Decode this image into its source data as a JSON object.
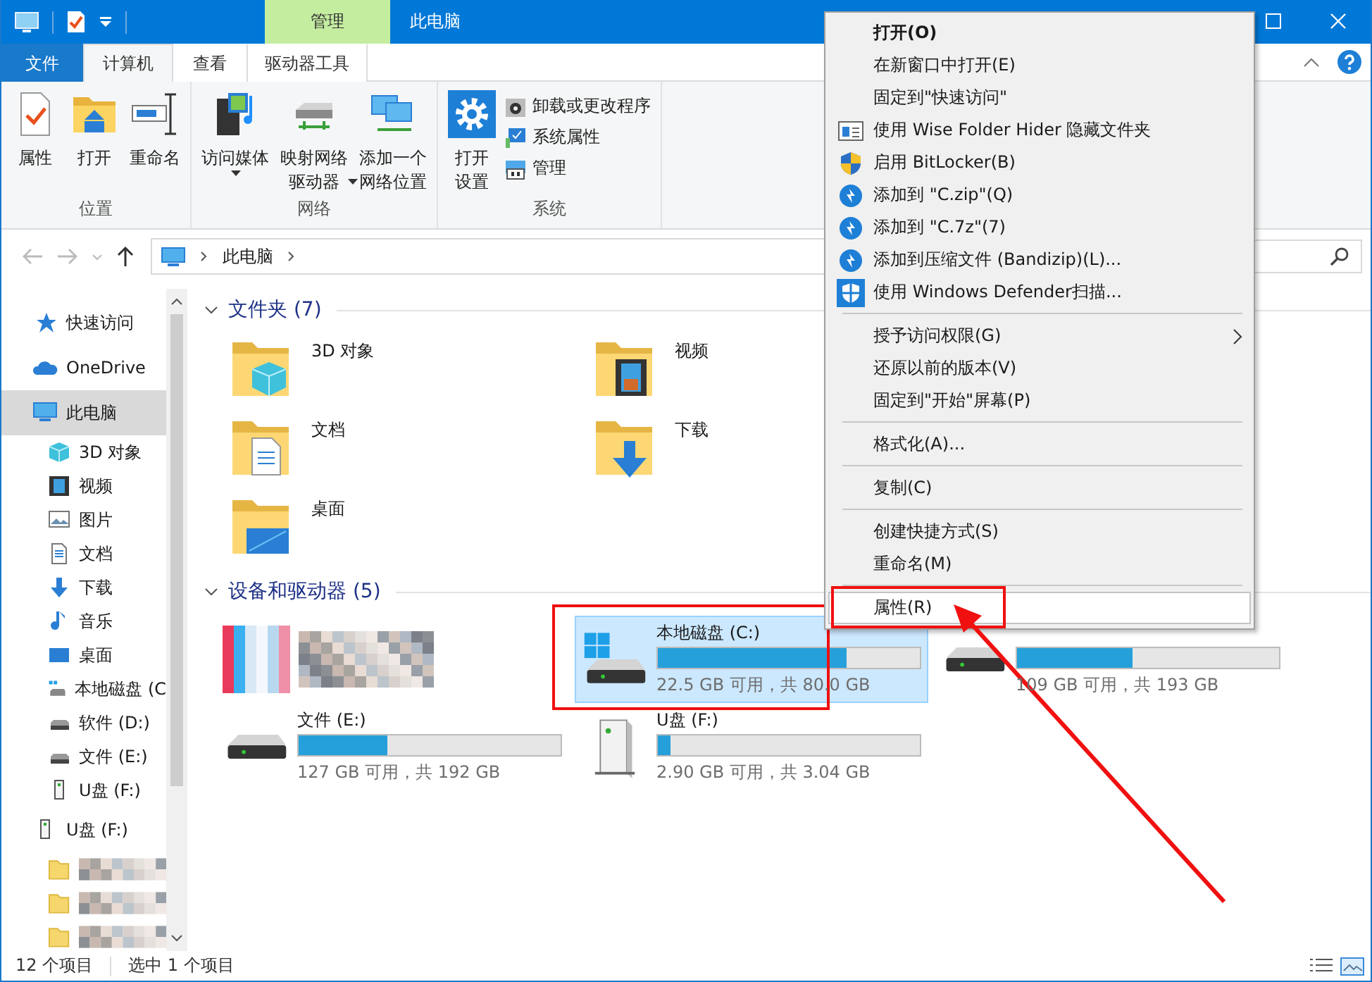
{
  "window": {
    "title": "此电脑",
    "context_tab_group": "管理"
  },
  "ribbon_tabs": [
    {
      "label": "文件",
      "kind": "file",
      "selected": false
    },
    {
      "label": "计算机",
      "kind": "tab",
      "selected": true
    },
    {
      "label": "查看",
      "kind": "tab",
      "selected": false
    },
    {
      "label": "驱动器工具",
      "kind": "context",
      "selected": false
    }
  ],
  "ribbon_groups": [
    {
      "name": "位置",
      "buttons": [
        {
          "lines": [
            "属性"
          ],
          "kind": "properties",
          "dropdown": false
        },
        {
          "lines": [
            "打开"
          ],
          "kind": "open",
          "dropdown": false
        },
        {
          "lines": [
            "重命名"
          ],
          "kind": "rename",
          "dropdown": false
        }
      ]
    },
    {
      "name": "网络",
      "buttons": [
        {
          "lines": [
            "访问媒体"
          ],
          "kind": "media",
          "dropdown": true
        },
        {
          "lines": [
            "映射网络",
            "驱动器"
          ],
          "kind": "map-drive",
          "dropdown": true
        },
        {
          "lines": [
            "添加一个",
            "网络位置"
          ],
          "kind": "network-location",
          "dropdown": false
        }
      ]
    },
    {
      "name": "系统",
      "buttons": [
        {
          "lines": [
            "打开",
            "设置"
          ],
          "kind": "settings",
          "dropdown": false
        }
      ],
      "small_buttons": [
        {
          "label": "卸载或更改程序",
          "kind": "uninstall"
        },
        {
          "label": "系统属性",
          "kind": "system-properties"
        },
        {
          "label": "管理",
          "kind": "manage"
        }
      ]
    }
  ],
  "address": {
    "path": [
      "此电脑"
    ]
  },
  "navigation": [
    {
      "label": "快速访问",
      "kind": "star",
      "selected": false
    },
    {
      "label": "OneDrive",
      "kind": "cloud",
      "selected": false
    },
    {
      "label": "此电脑",
      "kind": "pc",
      "selected": true,
      "children": [
        {
          "label": "3D 对象",
          "kind": "cube"
        },
        {
          "label": "视频",
          "kind": "video"
        },
        {
          "label": "图片",
          "kind": "picture"
        },
        {
          "label": "文档",
          "kind": "document"
        },
        {
          "label": "下载",
          "kind": "download"
        },
        {
          "label": "音乐",
          "kind": "music"
        },
        {
          "label": "桌面",
          "kind": "desktop"
        },
        {
          "label": "本地磁盘 (C",
          "kind": "windows"
        },
        {
          "label": "软件 (D:)",
          "kind": "hdd"
        },
        {
          "label": "文件 (E:)",
          "kind": "hdd"
        },
        {
          "label": "U盘 (F:)",
          "kind": "usb"
        }
      ]
    },
    {
      "label": "U盘 (F:)",
      "kind": "usb",
      "selected": false,
      "children": [
        {
          "kind": "blurred"
        },
        {
          "kind": "blurred"
        },
        {
          "kind": "blurred"
        }
      ]
    }
  ],
  "sections": [
    {
      "title": "文件夹 (7)",
      "kind": "folders",
      "expanded": true,
      "items": [
        {
          "name": "3D 对象",
          "kind": "cube"
        },
        {
          "name": "视频",
          "kind": "video"
        },
        {
          "name": "文档",
          "kind": "document"
        },
        {
          "name": "下载",
          "kind": "download"
        },
        {
          "name": "桌面",
          "kind": "desktop"
        }
      ]
    },
    {
      "title": "设备和驱动器 (5)",
      "kind": "drives",
      "expanded": true,
      "items": [
        {
          "kind": "blurred",
          "selected": false
        },
        {
          "kind": "windows",
          "name": "本地磁盘 (C:)",
          "level": 0.72,
          "space": "22.5 GB 可用，共 80.0 GB",
          "selected": true,
          "annotated": true
        },
        {
          "kind": "hdd",
          "level": 0.44,
          "space": "109 GB 可用，共 193 GB",
          "selected": false,
          "annotated": false
        },
        {
          "kind": "hdd",
          "name": "文件 (E:)",
          "level": 0.34,
          "space": "127 GB 可用，共 192 GB",
          "selected": false,
          "annotated": false
        },
        {
          "kind": "usb",
          "name": "U盘 (F:)",
          "level": 0.05,
          "space": "2.90 GB 可用，共 3.04 GB",
          "selected": false,
          "annotated": false
        }
      ]
    }
  ],
  "context_menu": {
    "groups": [
      [
        {
          "label": "打开(O)",
          "kind": "plain",
          "bold": true,
          "submenu": false,
          "selected": false,
          "annotated": false
        },
        {
          "label": "在新窗口中打开(E)",
          "kind": "plain",
          "bold": false,
          "submenu": false,
          "selected": false,
          "annotated": false
        },
        {
          "label": "固定到\"快速访问\"",
          "kind": "plain",
          "bold": false,
          "submenu": false,
          "selected": false,
          "annotated": false
        },
        {
          "label": "使用 Wise Folder Hider 隐藏文件夹",
          "kind": "wise",
          "bold": false,
          "submenu": false,
          "selected": false,
          "annotated": false
        },
        {
          "label": "启用 BitLocker(B)",
          "kind": "shield",
          "bold": false,
          "submenu": false,
          "selected": false,
          "annotated": false
        },
        {
          "label": "添加到 \"C.zip\"(Q)",
          "kind": "zip",
          "bold": false,
          "submenu": false,
          "selected": false,
          "annotated": false
        },
        {
          "label": "添加到 \"C.7z\"(7)",
          "kind": "zip",
          "bold": false,
          "submenu": false,
          "selected": false,
          "annotated": false
        },
        {
          "label": "添加到压缩文件 (Bandizip)(L)...",
          "kind": "zip",
          "bold": false,
          "submenu": false,
          "selected": false,
          "annotated": false
        },
        {
          "label": "使用 Windows Defender扫描...",
          "kind": "defender",
          "bold": false,
          "submenu": false,
          "selected": false,
          "annotated": false
        }
      ],
      [
        {
          "label": "授予访问权限(G)",
          "kind": "plain",
          "bold": false,
          "submenu": true,
          "selected": false,
          "annotated": false
        },
        {
          "label": "还原以前的版本(V)",
          "kind": "plain",
          "bold": false,
          "submenu": false,
          "selected": false,
          "annotated": false
        },
        {
          "label": "固定到\"开始\"屏幕(P)",
          "kind": "plain",
          "bold": false,
          "submenu": false,
          "selected": false,
          "annotated": false
        }
      ],
      [
        {
          "label": "格式化(A)...",
          "kind": "plain",
          "bold": false,
          "submenu": false,
          "selected": false,
          "annotated": false
        }
      ],
      [
        {
          "label": "复制(C)",
          "kind": "plain",
          "bold": false,
          "submenu": false,
          "selected": false,
          "annotated": false
        }
      ],
      [
        {
          "label": "创建快捷方式(S)",
          "kind": "plain",
          "bold": false,
          "submenu": false,
          "selected": false,
          "annotated": false
        },
        {
          "label": "重命名(M)",
          "kind": "plain",
          "bold": false,
          "submenu": false,
          "selected": false,
          "annotated": false
        }
      ],
      [
        {
          "label": "属性(R)",
          "kind": "plain",
          "bold": false,
          "submenu": false,
          "selected": true,
          "annotated": true
        }
      ]
    ]
  },
  "pointer_arrow": true,
  "status_bar": {
    "item_count": "12 个项目",
    "selection": "选中 1 个项目"
  }
}
